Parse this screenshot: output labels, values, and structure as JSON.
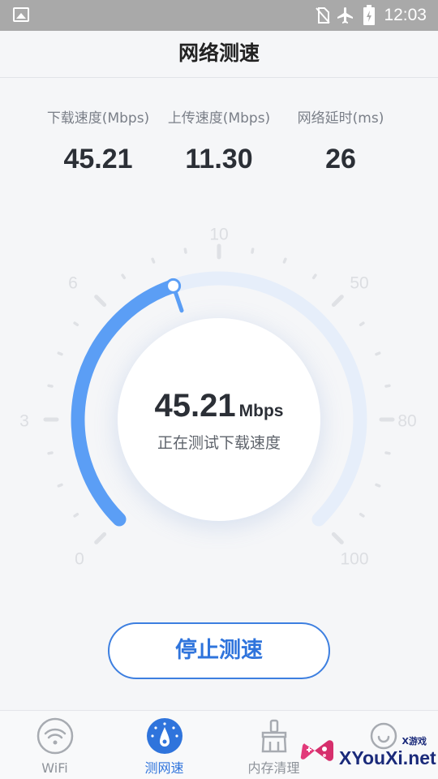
{
  "status_bar": {
    "time": "12:03",
    "icons": [
      "image-icon",
      "no-sim-icon",
      "airplane-icon",
      "battery-charging-icon"
    ]
  },
  "header": {
    "title": "网络测速"
  },
  "stats": [
    {
      "label": "下载速度(Mbps)",
      "value": "45.21"
    },
    {
      "label": "上传速度(Mbps)",
      "value": "11.30"
    },
    {
      "label": "网络延时(ms)",
      "value": "26"
    }
  ],
  "gauge": {
    "scale_labels": [
      "0",
      "3",
      "6",
      "10",
      "50",
      "80",
      "100"
    ],
    "speed_value": "45.21",
    "speed_unit": "Mbps",
    "status_text": "正在测试下载速度",
    "progress_fraction": 0.43,
    "accent_color": "#5b9ef5"
  },
  "stop_button": {
    "label": "停止测速"
  },
  "bottom_nav": {
    "items": [
      {
        "label": "WiFi",
        "icon": "wifi-icon",
        "active": false
      },
      {
        "label": "测网速",
        "icon": "speedometer-icon",
        "active": true
      },
      {
        "label": "内存清理",
        "icon": "broom-icon",
        "active": false
      },
      {
        "label": "",
        "icon": "clock-icon",
        "active": false
      }
    ]
  },
  "watermark": {
    "text": "XYouXi.net",
    "small_text": "X游戏"
  }
}
